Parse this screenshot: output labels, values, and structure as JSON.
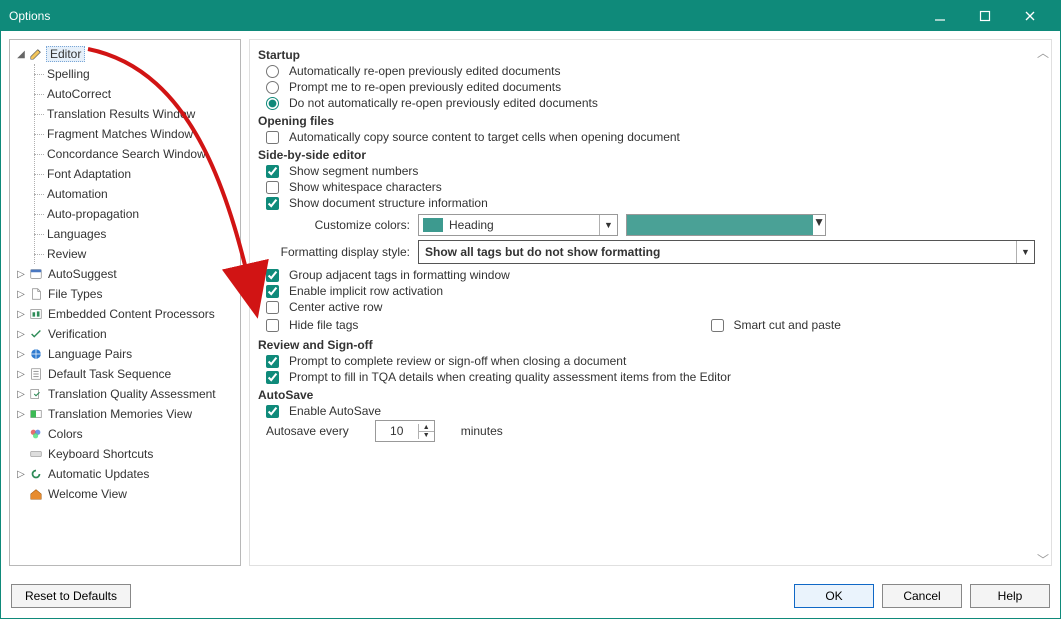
{
  "window": {
    "title": "Options"
  },
  "sidebar": {
    "items": [
      {
        "type": "node",
        "label": "Editor",
        "icon": "pencil-icon",
        "expanded": true,
        "selected": true,
        "children": [
          {
            "label": "Spelling"
          },
          {
            "label": "AutoCorrect"
          },
          {
            "label": "Translation Results Window"
          },
          {
            "label": "Fragment Matches Window"
          },
          {
            "label": "Concordance Search Window"
          },
          {
            "label": "Font Adaptation"
          },
          {
            "label": "Automation"
          },
          {
            "label": "Auto-propagation"
          },
          {
            "label": "Languages"
          },
          {
            "label": "Review"
          }
        ]
      },
      {
        "label": "AutoSuggest",
        "icon": "autosuggest-icon"
      },
      {
        "label": "File Types",
        "icon": "filetypes-icon"
      },
      {
        "label": "Embedded Content Processors",
        "icon": "embedded-icon"
      },
      {
        "label": "Verification",
        "icon": "verification-icon"
      },
      {
        "label": "Language Pairs",
        "icon": "langpairs-icon"
      },
      {
        "label": "Default Task Sequence",
        "icon": "tasks-icon"
      },
      {
        "label": "Translation Quality Assessment",
        "icon": "tqa-icon"
      },
      {
        "label": "Translation Memories View",
        "icon": "tmview-icon"
      },
      {
        "label": "Colors",
        "icon": "colors-icon"
      },
      {
        "label": "Keyboard Shortcuts",
        "icon": "keyboard-icon"
      },
      {
        "label": "Automatic Updates",
        "icon": "updates-icon"
      },
      {
        "label": "Welcome View",
        "icon": "welcome-icon"
      }
    ]
  },
  "panel": {
    "sections": {
      "startup": {
        "title": "Startup",
        "radios": [
          "Automatically re-open previously edited documents",
          "Prompt me to re-open previously edited documents",
          "Do not automatically re-open previously edited documents"
        ],
        "selected": 2
      },
      "opening_files": {
        "title": "Opening files",
        "auto_copy_label": "Automatically copy source content to target cells when opening document",
        "auto_copy_checked": false
      },
      "side_by_side": {
        "title": "Side-by-side editor",
        "show_segment_numbers_label": "Show segment numbers",
        "show_segment_numbers": true,
        "show_whitespace_label": "Show whitespace characters",
        "show_whitespace": false,
        "show_doc_structure_label": "Show document structure information",
        "show_doc_structure": true,
        "customize_colors_label": "Customize colors:",
        "color_combo_value": "Heading",
        "color_swatch_hex": "#4aa196",
        "formatting_label": "Formatting display style:",
        "formatting_value": "Show all tags but do not show formatting",
        "group_adjacent_label": "Group adjacent tags in formatting window",
        "group_adjacent": true,
        "enable_implicit_label": "Enable implicit row activation",
        "enable_implicit": true,
        "center_active_label": "Center active row",
        "center_active": false,
        "hide_file_tags_label": "Hide file tags",
        "hide_file_tags": false,
        "smart_cut_paste_label": "Smart cut and paste",
        "smart_cut_paste": false
      },
      "review": {
        "title": "Review and Sign-off",
        "prompt_complete_label": "Prompt to complete review or sign-off when closing a document",
        "prompt_complete": true,
        "prompt_tqa_label": "Prompt to fill in TQA details when creating quality assessment items from the Editor",
        "prompt_tqa": true
      },
      "autosave": {
        "title": "AutoSave",
        "enable_label": "Enable AutoSave",
        "enable": true,
        "every_label": "Autosave every",
        "value": "10",
        "unit": "minutes"
      }
    }
  },
  "footer": {
    "reset": "Reset to Defaults",
    "ok": "OK",
    "cancel": "Cancel",
    "help": "Help"
  }
}
